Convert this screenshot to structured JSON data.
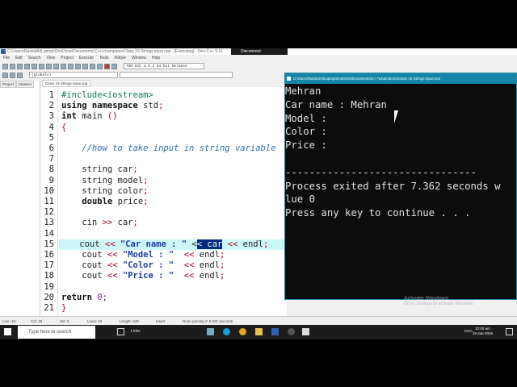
{
  "window_title": "C:\\Users\\RashidAliLaptop\\OneDrive\\Documents\\C++\\champions\\Class 19 Strings input.cpp - [Executing] - Dev-C++ 5.11",
  "rdp": {
    "disconnect_label": "Disconnect"
  },
  "menu": [
    "File",
    "Edit",
    "Search",
    "View",
    "Project",
    "Execute",
    "Tools",
    "AStyle",
    "Window",
    "Help"
  ],
  "compiler_select": "TDM-GCC 4.9.2 64-bit Release",
  "scope_select": "(globals)",
  "panel_tabs": [
    "Project",
    "Classes"
  ],
  "file_tab": "Class 19 Strings input.cpp",
  "code_lines": [
    [
      [
        "#include<iostream>",
        "pre"
      ]
    ],
    [
      [
        "using namespace ",
        "kw"
      ],
      [
        "std",
        ""
      ],
      [
        ";",
        "op"
      ]
    ],
    [
      [
        "int ",
        "kw"
      ],
      [
        "main ",
        ""
      ],
      [
        "()",
        "op"
      ]
    ],
    [
      [
        "{",
        "op"
      ]
    ],
    [],
    [
      [
        "    //how to take input in string variable",
        "cm"
      ]
    ],
    [],
    [
      [
        "    string car",
        ""
      ],
      [
        ";",
        "op"
      ]
    ],
    [
      [
        "    string model",
        ""
      ],
      [
        ";",
        "op"
      ]
    ],
    [
      [
        "    string color",
        ""
      ],
      [
        ";",
        "op"
      ]
    ],
    [
      [
        "    ",
        ""
      ],
      [
        "double ",
        "kw"
      ],
      [
        "price",
        ""
      ],
      [
        ";",
        "op"
      ]
    ],
    [],
    [
      [
        "    cin ",
        ""
      ],
      [
        ">>",
        "op"
      ],
      [
        " car",
        ""
      ],
      [
        ";",
        "op"
      ]
    ],
    [],
    [
      [
        "    cout ",
        ""
      ],
      [
        "<<",
        "op"
      ],
      [
        " ",
        ""
      ],
      [
        "\"Car name : \"",
        "str"
      ],
      [
        " <",
        ""
      ],
      [
        "< car",
        "selt"
      ],
      [
        " ",
        ""
      ],
      [
        "<<",
        "op"
      ],
      [
        " endl",
        ""
      ],
      [
        ";",
        "op"
      ]
    ],
    [
      [
        "    cout ",
        ""
      ],
      [
        "<<",
        "op"
      ],
      [
        " ",
        ""
      ],
      [
        "\"Model : \"",
        "str"
      ],
      [
        "  ",
        ""
      ],
      [
        "<<",
        "op"
      ],
      [
        " endl",
        ""
      ],
      [
        ";",
        "op"
      ]
    ],
    [
      [
        "    cout ",
        ""
      ],
      [
        "<<",
        "op"
      ],
      [
        " ",
        ""
      ],
      [
        "\"Color : \"",
        "str"
      ],
      [
        "  ",
        ""
      ],
      [
        "<<",
        "op"
      ],
      [
        " endl",
        ""
      ],
      [
        ";",
        "op"
      ]
    ],
    [
      [
        "    cout ",
        ""
      ],
      [
        "<<",
        "op"
      ],
      [
        " ",
        ""
      ],
      [
        "\"Price : \"",
        "str"
      ],
      [
        "  ",
        ""
      ],
      [
        "<<",
        "op"
      ],
      [
        " endl",
        ""
      ],
      [
        ";",
        "op"
      ]
    ],
    [],
    [
      [
        "return ",
        "kw"
      ],
      [
        "0",
        "num"
      ],
      [
        ";",
        "op"
      ]
    ],
    [
      [
        "}",
        "op"
      ]
    ]
  ],
  "highlight_line": 15,
  "status": {
    "line": "Line: 15",
    "col": "Col: 28",
    "sel": "Sel: 5",
    "lines": "Lines: 22",
    "length": "Length: 340",
    "mode": "Insert",
    "message": "Done parsing in 0.032 seconds"
  },
  "console": {
    "title": "C:\\Users\\RashidAliLaptop\\OneDrive\\Documents\\C++\\champions\\Class 19 Strings input.exe",
    "lines": [
      "Mehran",
      "Car name : Mehran",
      "Model :",
      "Color :",
      "Price :",
      "",
      "--------------------------------",
      "Process exited after 7.362 seconds w",
      "lue 0",
      "Press any key to continue . . ."
    ]
  },
  "watermark": {
    "title": "Activate Windows",
    "subtitle": "Go to Settings to activate Windows."
  },
  "taskbar": {
    "search_placeholder": "Type here to search",
    "links_label": "Links",
    "time": "10:00 am",
    "date": "19-Jan-2026",
    "lang": "ENG"
  }
}
